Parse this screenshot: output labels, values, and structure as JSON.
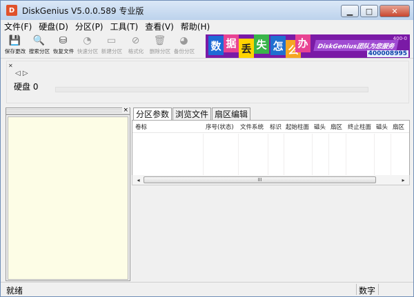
{
  "window": {
    "title": "DiskGenius V5.0.0.589 专业版",
    "icon_text": "D"
  },
  "window_buttons": {
    "minimize": "▁",
    "maximize": "□",
    "close": "✕"
  },
  "menu": [
    {
      "label": "文件(F)"
    },
    {
      "label": "硬盘(D)"
    },
    {
      "label": "分区(P)"
    },
    {
      "label": "工具(T)"
    },
    {
      "label": "查看(V)"
    },
    {
      "label": "帮助(H)"
    }
  ],
  "toolbar": [
    {
      "label": "保存更改",
      "icon": "save-icon",
      "glyph": "💾",
      "enabled": true
    },
    {
      "label": "搜索分区",
      "icon": "search-icon",
      "glyph": "🔍",
      "enabled": true
    },
    {
      "label": "恢复文件",
      "icon": "restore-file-icon",
      "glyph": "⛁",
      "enabled": true
    },
    {
      "label": "快速分区",
      "icon": "quick-partition-icon",
      "glyph": "◔",
      "enabled": false
    },
    {
      "label": "新建分区",
      "icon": "new-partition-icon",
      "glyph": "▭",
      "enabled": false
    },
    {
      "label": "格式化",
      "icon": "format-icon",
      "glyph": "⊘",
      "enabled": false
    },
    {
      "label": "删除分区",
      "icon": "delete-partition-icon",
      "glyph": "🗑",
      "enabled": false
    },
    {
      "label": "备份分区",
      "icon": "backup-partition-icon",
      "glyph": "◕",
      "enabled": false
    }
  ],
  "banner": {
    "tiles": [
      "数",
      "据",
      "丢",
      "失",
      "怎",
      "么",
      "办"
    ],
    "slogan": "DiskGenius团队为您服务",
    "phone": "400008995",
    "tag": "400-0"
  },
  "disk": {
    "label": "硬盘  0",
    "nav_arrows": "◁ ▷"
  },
  "left_panel": {
    "close": "×"
  },
  "tabs": [
    {
      "label": "分区参数",
      "active": true
    },
    {
      "label": "浏览文件",
      "active": false
    },
    {
      "label": "扇区编辑",
      "active": false
    }
  ],
  "columns": [
    "卷标",
    "序号(状态)",
    "文件系统",
    "标识",
    "起始柱面",
    "磁头",
    "扇区",
    "终止柱面",
    "磁头",
    "扇区"
  ],
  "scrollbar": {
    "left": "◂",
    "right": "▸",
    "grip": "III"
  },
  "status": {
    "left": "就绪",
    "mode": "数字"
  },
  "colors": {
    "banner_bg": "#7a1aa6",
    "tree_bg": "#fdfde6",
    "title_bar": "#bcd2ec"
  }
}
